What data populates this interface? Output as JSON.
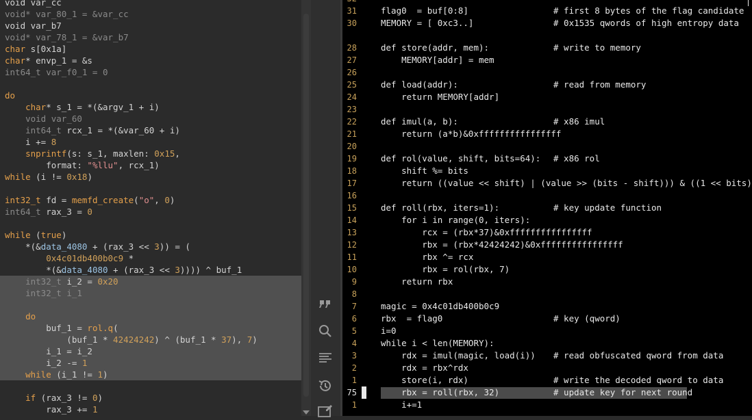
{
  "left": {
    "lines": [
      [
        [
          "t-txt",
          "void var_cc"
        ]
      ],
      [
        [
          "t-dim",
          "void* var_80_1 = &var_cc"
        ]
      ],
      [
        [
          "t-txt",
          "void var_b7"
        ]
      ],
      [
        [
          "t-dim",
          "void* var_78_1 = &var_b7"
        ]
      ],
      [
        [
          "t-type",
          "char"
        ],
        [
          "t-txt",
          " s[0x1a]"
        ]
      ],
      [
        [
          "t-type",
          "char"
        ],
        [
          "t-txt",
          "* envp_1 = &s"
        ]
      ],
      [
        [
          "t-dim",
          "int64_t var_f0_1 = 0"
        ]
      ],
      [
        [
          "t-txt",
          ""
        ]
      ],
      [
        [
          "t-kw",
          "do"
        ]
      ],
      [
        [
          "t-txt",
          "    "
        ],
        [
          "t-type",
          "char"
        ],
        [
          "t-txt",
          "* s_1 = *(&argv_1 + i)"
        ]
      ],
      [
        [
          "t-txt",
          "    "
        ],
        [
          "t-dim",
          "void var_60"
        ]
      ],
      [
        [
          "t-txt",
          "    "
        ],
        [
          "t-dim",
          "int64_t"
        ],
        [
          "t-txt",
          " rcx_1 = *(&var_60 + i)"
        ]
      ],
      [
        [
          "t-txt",
          "    i += "
        ],
        [
          "t-num",
          "8"
        ]
      ],
      [
        [
          "t-txt",
          "    "
        ],
        [
          "t-fn",
          "snprintf"
        ],
        [
          "t-txt",
          "(s: s_1, maxlen: "
        ],
        [
          "t-num",
          "0x15"
        ],
        [
          "t-txt",
          ","
        ]
      ],
      [
        [
          "t-txt",
          "        format: "
        ],
        [
          "t-str",
          "\"%llu\""
        ],
        [
          "t-txt",
          ", rcx_1)"
        ]
      ],
      [
        [
          "t-kw",
          "while"
        ],
        [
          "t-txt",
          " (i != "
        ],
        [
          "t-num",
          "0x18"
        ],
        [
          "t-txt",
          ")"
        ]
      ],
      [
        [
          "t-txt",
          ""
        ]
      ],
      [
        [
          "t-type",
          "int32_t"
        ],
        [
          "t-txt",
          " fd = "
        ],
        [
          "t-fn",
          "memfd_create"
        ],
        [
          "t-txt",
          "("
        ],
        [
          "t-str",
          "\"o\""
        ],
        [
          "t-txt",
          ", "
        ],
        [
          "t-num",
          "0"
        ],
        [
          "t-txt",
          ")"
        ]
      ],
      [
        [
          "t-dim",
          "int64_t"
        ],
        [
          "t-txt",
          " rax_3 = "
        ],
        [
          "t-num",
          "0"
        ]
      ],
      [
        [
          "t-txt",
          ""
        ]
      ],
      [
        [
          "t-kw",
          "while"
        ],
        [
          "t-txt",
          " ("
        ],
        [
          "t-kw",
          "true"
        ],
        [
          "t-txt",
          ")"
        ]
      ],
      [
        [
          "t-txt",
          "    *(&"
        ],
        [
          "t-var",
          "data_4080"
        ],
        [
          "t-txt",
          " + (rax_3 << "
        ],
        [
          "t-num",
          "3"
        ],
        [
          "t-txt",
          ")) = ("
        ]
      ],
      [
        [
          "t-txt",
          "        "
        ],
        [
          "t-num",
          "0x4c01db400b0c9"
        ],
        [
          "t-txt",
          " *"
        ]
      ],
      [
        [
          "t-txt",
          "        *(&"
        ],
        [
          "t-var",
          "data_4080"
        ],
        [
          "t-txt",
          " + (rax_3 << "
        ],
        [
          "t-num",
          "3"
        ],
        [
          "t-txt",
          ")))) ^ buf_1"
        ]
      ],
      [
        [
          "t-txt",
          "    "
        ],
        [
          "t-dim",
          "int32_t"
        ],
        [
          "t-txt",
          " i_2 = "
        ],
        [
          "t-num",
          "0x20"
        ]
      ],
      [
        [
          "t-txt",
          "    "
        ],
        [
          "t-dim",
          "int32_t i_1"
        ]
      ],
      [
        [
          "t-txt",
          ""
        ]
      ],
      [
        [
          "t-txt",
          "    "
        ],
        [
          "t-kw",
          "do"
        ]
      ],
      [
        [
          "t-txt",
          "        buf_1 = "
        ],
        [
          "t-fn",
          "rol.q"
        ],
        [
          "t-txt",
          "("
        ]
      ],
      [
        [
          "t-txt",
          "            (buf_1 * "
        ],
        [
          "t-num",
          "42424242"
        ],
        [
          "t-txt",
          ") ^ (buf_1 * "
        ],
        [
          "t-num",
          "37"
        ],
        [
          "t-txt",
          "), "
        ],
        [
          "t-num",
          "7"
        ],
        [
          "t-txt",
          ")"
        ]
      ],
      [
        [
          "t-txt",
          "        i_1 = i_2"
        ]
      ],
      [
        [
          "t-txt",
          "        i_2 -= "
        ],
        [
          "t-num",
          "1"
        ]
      ],
      [
        [
          "t-txt",
          "    "
        ],
        [
          "t-kw",
          "while"
        ],
        [
          "t-txt",
          " (i_1 != "
        ],
        [
          "t-num",
          "1"
        ],
        [
          "t-txt",
          ")"
        ]
      ],
      [
        [
          "t-txt",
          ""
        ]
      ],
      [
        [
          "t-txt",
          "    "
        ],
        [
          "t-kw",
          "if"
        ],
        [
          "t-txt",
          " (rax_3 != "
        ],
        [
          "t-num",
          "0"
        ],
        [
          "t-txt",
          ")"
        ]
      ],
      [
        [
          "t-txt",
          "        rax_3 += "
        ],
        [
          "t-num",
          "1"
        ]
      ]
    ]
  },
  "right": {
    "lines": [
      {
        "n": "32",
        "code": "",
        "comment": ""
      },
      {
        "n": "31",
        "code": "flag0  = buf[0:8]",
        "comment": "# first 8 bytes of the flag candidate"
      },
      {
        "n": "30",
        "code": "MEMORY = [ 0xc3..]",
        "comment": "# 0x1535 qwords of high entropy data"
      },
      {
        "n": "",
        "code": "",
        "comment": ""
      },
      {
        "n": "28",
        "code": "def store(addr, mem):",
        "comment": "# write to memory"
      },
      {
        "n": "27",
        "code": "    MEMORY[addr] = mem",
        "comment": ""
      },
      {
        "n": "26",
        "code": "",
        "comment": ""
      },
      {
        "n": "25",
        "code": "def load(addr):",
        "comment": "# read from memory"
      },
      {
        "n": "24",
        "code": "    return MEMORY[addr]",
        "comment": ""
      },
      {
        "n": "23",
        "code": "",
        "comment": ""
      },
      {
        "n": "22",
        "code": "def imul(a, b):",
        "comment": "# x86 imul"
      },
      {
        "n": "21",
        "code": "    return (a*b)&0xffffffffffffffff",
        "comment": ""
      },
      {
        "n": "20",
        "code": "",
        "comment": ""
      },
      {
        "n": "19",
        "code": "def rol(value, shift, bits=64):",
        "comment": "# x86 rol"
      },
      {
        "n": "18",
        "code": "    shift %= bits",
        "comment": ""
      },
      {
        "n": "17",
        "code": "    return ((value << shift) | (value >> (bits - shift))) & ((1 << bits) - 1)",
        "comment": ""
      },
      {
        "n": "16",
        "code": "",
        "comment": ""
      },
      {
        "n": "15",
        "code": "def roll(rbx, iters=1):",
        "comment": "# key update function"
      },
      {
        "n": "14",
        "code": "    for i in range(0, iters):",
        "comment": ""
      },
      {
        "n": "13",
        "code": "        rcx = (rbx*37)&0xffffffffffffffff",
        "comment": ""
      },
      {
        "n": "12",
        "code": "        rbx = (rbx*42424242)&0xffffffffffffffff",
        "comment": ""
      },
      {
        "n": "11",
        "code": "        rbx ^= rcx",
        "comment": ""
      },
      {
        "n": "10",
        "code": "        rbx = rol(rbx, 7)",
        "comment": ""
      },
      {
        "n": "9",
        "code": "    return rbx",
        "comment": ""
      },
      {
        "n": "8",
        "code": "",
        "comment": ""
      },
      {
        "n": "7",
        "code": "magic = 0x4c01db400b0c9",
        "comment": ""
      },
      {
        "n": "6",
        "code": "rbx  = flag0",
        "comment": "# key (qword)"
      },
      {
        "n": "5",
        "code": "i=0",
        "comment": ""
      },
      {
        "n": "4",
        "code": "while i < len(MEMORY):",
        "comment": ""
      },
      {
        "n": "3",
        "code": "    rdx = imul(magic, load(i))",
        "comment": "# read obfuscated qword from data"
      },
      {
        "n": "2",
        "code": "    rdx = rbx^rdx",
        "comment": ""
      },
      {
        "n": "1",
        "code": "    store(i, rdx)",
        "comment": "# write the decoded qword to data"
      },
      {
        "n": "75",
        "code": "    rbx = roll(rbx, 32)",
        "comment": "# update key for next round",
        "current": true
      },
      {
        "n": "1",
        "code": "    i+=1",
        "comment": ""
      }
    ]
  },
  "toolbar": {
    "icons": [
      "quote-icon",
      "search-icon",
      "text-lines-icon",
      "history-icon",
      "image-edit-icon"
    ]
  }
}
